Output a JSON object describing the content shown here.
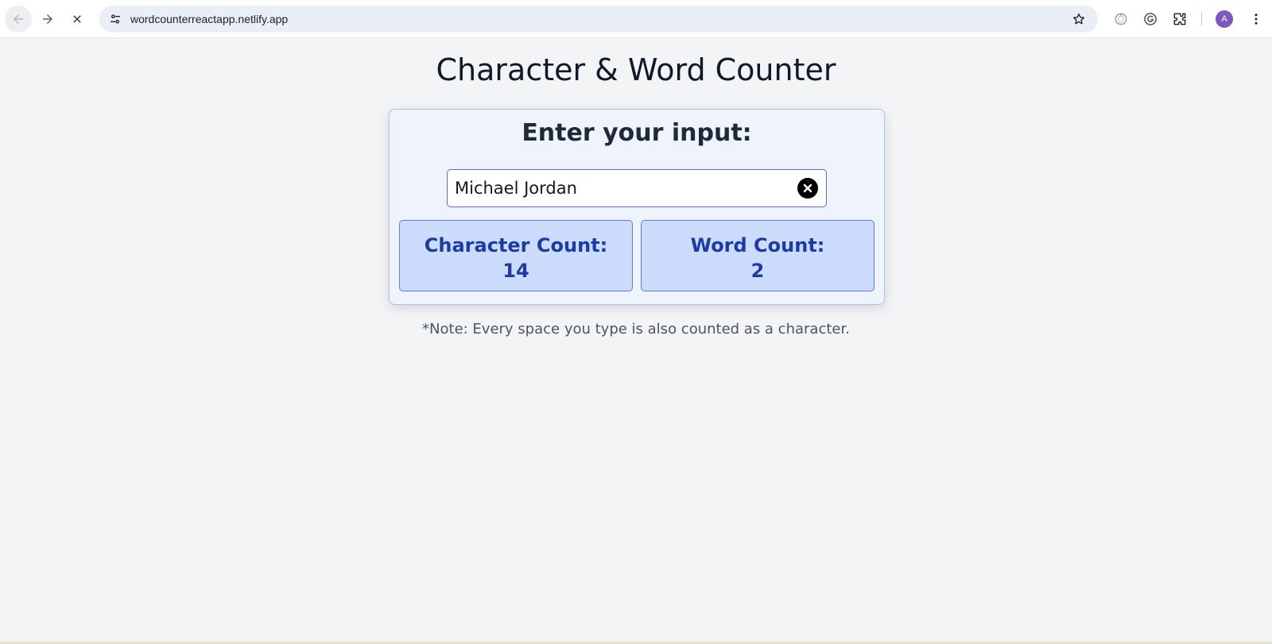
{
  "browser": {
    "url": "wordcounterreactapp.netlify.app",
    "profile_initial": "A",
    "icons": {
      "back": "arrow-left-icon",
      "forward": "arrow-right-icon",
      "stop": "close-icon",
      "site_info": "tune-icon",
      "bookmark": "star-icon",
      "extensions": "puzzle-icon",
      "menu": "more-vert-icon"
    }
  },
  "page": {
    "title": "Character & Word Counter",
    "card": {
      "heading": "Enter your input:",
      "input_value": "Michael Jordan",
      "char_label": "Character Count:",
      "char_value": "14",
      "word_label": "Word Count:",
      "word_value": "2"
    },
    "note": "*Note: Every space you type is also counted as a character."
  },
  "colors": {
    "page_bg": "#f3f4f6",
    "card_bg": "#eef3fc",
    "stat_bg": "#cbdcfc",
    "stat_text": "#1e3aa8",
    "avatar": "#7e57c2"
  }
}
